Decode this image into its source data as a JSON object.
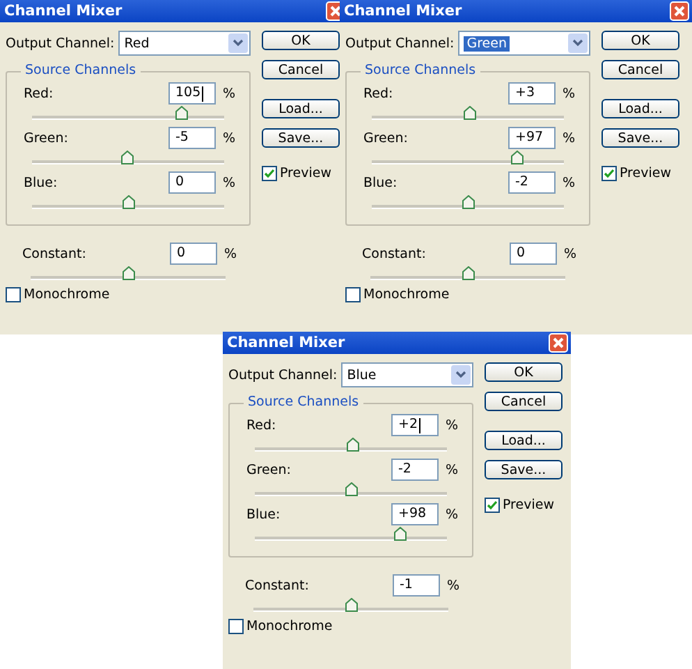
{
  "dialogs": [
    {
      "title": "Channel Mixer",
      "output_channel": {
        "label": "Output Channel:",
        "value": "Red",
        "focused": false
      },
      "source_group": "Source Channels",
      "channels": [
        {
          "name": "Red:",
          "value": "105",
          "unit": "%",
          "level": 0.76,
          "caret": true
        },
        {
          "name": "Green:",
          "value": "-5",
          "unit": "%",
          "level": 0.49,
          "caret": false
        },
        {
          "name": "Blue:",
          "value": "0",
          "unit": "%",
          "level": 0.5,
          "caret": false
        }
      ],
      "constant": {
        "name": "Constant:",
        "value": "0",
        "unit": "%",
        "level": 0.5
      },
      "monochrome": {
        "label": "Monochrome",
        "checked": false
      },
      "buttons": [
        "OK",
        "Cancel",
        "Load...",
        "Save..."
      ],
      "preview": {
        "label": "Preview",
        "checked": true
      }
    },
    {
      "title": "Channel Mixer",
      "output_channel": {
        "label": "Output Channel:",
        "value": "Green",
        "focused": true
      },
      "source_group": "Source Channels",
      "channels": [
        {
          "name": "Red:",
          "value": "+3",
          "unit": "%",
          "level": 0.51,
          "caret": false
        },
        {
          "name": "Green:",
          "value": "+97",
          "unit": "%",
          "level": 0.74,
          "caret": false
        },
        {
          "name": "Blue:",
          "value": "-2",
          "unit": "%",
          "level": 0.5,
          "caret": false
        }
      ],
      "constant": {
        "name": "Constant:",
        "value": "0",
        "unit": "%",
        "level": 0.5
      },
      "monochrome": {
        "label": "Monochrome",
        "checked": false
      },
      "buttons": [
        "OK",
        "Cancel",
        "Load...",
        "Save..."
      ],
      "preview": {
        "label": "Preview",
        "checked": true
      }
    },
    {
      "title": "Channel Mixer",
      "output_channel": {
        "label": "Output Channel:",
        "value": "Blue",
        "focused": false
      },
      "source_group": "Source Channels",
      "channels": [
        {
          "name": "Red:",
          "value": "+2",
          "unit": "%",
          "level": 0.51,
          "caret": true
        },
        {
          "name": "Green:",
          "value": "-2",
          "unit": "%",
          "level": 0.5,
          "caret": false
        },
        {
          "name": "Blue:",
          "value": "+98",
          "unit": "%",
          "level": 0.74,
          "caret": false
        }
      ],
      "constant": {
        "name": "Constant:",
        "value": "-1",
        "unit": "%",
        "level": 0.5
      },
      "monochrome": {
        "label": "Monochrome",
        "checked": false
      },
      "buttons": [
        "OK",
        "Cancel",
        "Load...",
        "Save..."
      ],
      "preview": {
        "label": "Preview",
        "checked": true
      }
    }
  ]
}
